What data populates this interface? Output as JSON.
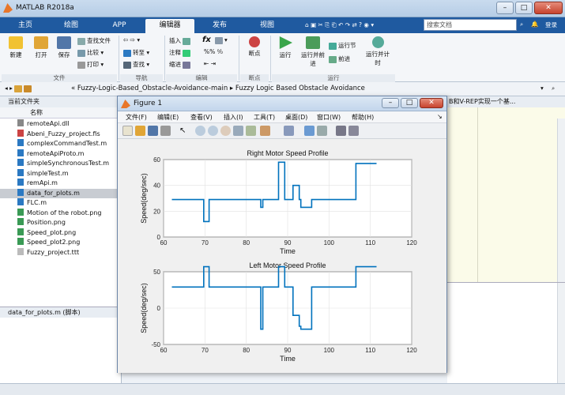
{
  "window": {
    "title": "MATLAB R2018a"
  },
  "tabs": [
    {
      "label": "主页"
    },
    {
      "label": "绘图"
    },
    {
      "label": "APP"
    },
    {
      "label": "编辑器",
      "active": true
    },
    {
      "label": "发布"
    },
    {
      "label": "视图"
    }
  ],
  "search": {
    "placeholder": "搜索文档"
  },
  "ribbon": {
    "file_group": {
      "label": "文件",
      "new": "新建",
      "open": "打开",
      "save": "保存",
      "find_files": "查找文件",
      "compare": "比较",
      "print": "打印"
    },
    "nav_group": {
      "label": "导航",
      "goto": "转至",
      "find": "查找"
    },
    "edit_group": {
      "label": "编辑",
      "insert": "插入",
      "comment": "注释",
      "indent": "缩进",
      "fx": "fx"
    },
    "breakpoints_group": {
      "label": "断点",
      "breakpoints": "断点"
    },
    "run_group": {
      "label": "运行",
      "run": "运行",
      "run_advance": "运行并前进",
      "run_section": "运行节",
      "advance": "前进",
      "run_time": "运行并计时"
    }
  },
  "addressbar": {
    "path": "« Fuzzy-Logic-Based_Obstacle-Avoidance-main  ▸  Fuzzy Logic Based Obstacle Avoidance"
  },
  "current_folder": {
    "title": "当前文件夹",
    "column_name": "名称",
    "files": [
      {
        "name": "remoteApi.dll",
        "type": "dll"
      },
      {
        "name": "Abeni_Fuzzy_project.fis",
        "type": "fis"
      },
      {
        "name": "complexCommandTest.m",
        "type": "m"
      },
      {
        "name": "remoteApiProto.m",
        "type": "m"
      },
      {
        "name": "simpleSynchronousTest.m",
        "type": "m"
      },
      {
        "name": "simpleTest.m",
        "type": "m"
      },
      {
        "name": "remApi.m",
        "type": "m"
      },
      {
        "name": "data_for_plots.m",
        "type": "m",
        "selected": true
      },
      {
        "name": "FLC.m",
        "type": "m"
      },
      {
        "name": "Motion of the robot.png",
        "type": "png"
      },
      {
        "name": "Position.png",
        "type": "png"
      },
      {
        "name": "Speed_plot.png",
        "type": "png"
      },
      {
        "name": "Speed_plot2.png",
        "type": "png"
      },
      {
        "name": "Fuzzy_project.ttt",
        "type": "ttt"
      }
    ],
    "details_label": "data_for_plots.m  (脚本)"
  },
  "editor": {
    "tab_text": "B和V-REP实现一个基..."
  },
  "figure": {
    "title": "Figure 1",
    "menu": [
      "文件(F)",
      "编辑(E)",
      "查看(V)",
      "插入(I)",
      "工具(T)",
      "桌面(D)",
      "窗口(W)",
      "帮助(H)"
    ]
  },
  "colors": {
    "tabbar": "#1f5aa0",
    "line": "#0072bd"
  },
  "chart_data": [
    {
      "type": "line",
      "title": "Right Motor Speed Profile",
      "xlabel": "Time",
      "ylabel": "Speed(deg/sec)",
      "xlim": [
        60,
        120
      ],
      "ylim": [
        0,
        60
      ],
      "xticks": [
        60,
        70,
        80,
        90,
        100,
        110,
        120
      ],
      "yticks": [
        0,
        20,
        40,
        60
      ],
      "grid": true,
      "x": [
        62,
        69.7,
        69.7,
        71,
        71,
        83.5,
        83.5,
        84,
        84,
        87.8,
        87.8,
        89.3,
        89.3,
        91.3,
        91.3,
        92.8,
        92.8,
        93.2,
        93.2,
        95.8,
        95.8,
        106.5,
        106.5,
        111.5
      ],
      "y": [
        29,
        29,
        12,
        12,
        29,
        29,
        23,
        23,
        29,
        29,
        58,
        58,
        29,
        29,
        40,
        40,
        29,
        29,
        23,
        23,
        29,
        29,
        57,
        57
      ]
    },
    {
      "type": "line",
      "title": "Left Motor Speed Profile",
      "xlabel": "Time",
      "ylabel": "Speed(deg/sec)",
      "xlim": [
        60,
        120
      ],
      "ylim": [
        -50,
        50
      ],
      "xticks": [
        60,
        70,
        80,
        90,
        100,
        110,
        120
      ],
      "yticks": [
        -50,
        0,
        50
      ],
      "grid": true,
      "x": [
        62,
        69.7,
        69.7,
        71,
        71,
        83.5,
        83.5,
        84,
        84,
        87.8,
        87.8,
        89.3,
        89.3,
        91.3,
        91.3,
        92.8,
        92.8,
        93.2,
        93.2,
        95.8,
        95.8,
        106.5,
        106.5,
        111.5
      ],
      "y": [
        29,
        29,
        57,
        57,
        29,
        29,
        -29,
        -29,
        29,
        29,
        57,
        57,
        29,
        29,
        -10,
        -10,
        -25,
        -25,
        -29,
        -29,
        29,
        29,
        57,
        57
      ]
    }
  ]
}
